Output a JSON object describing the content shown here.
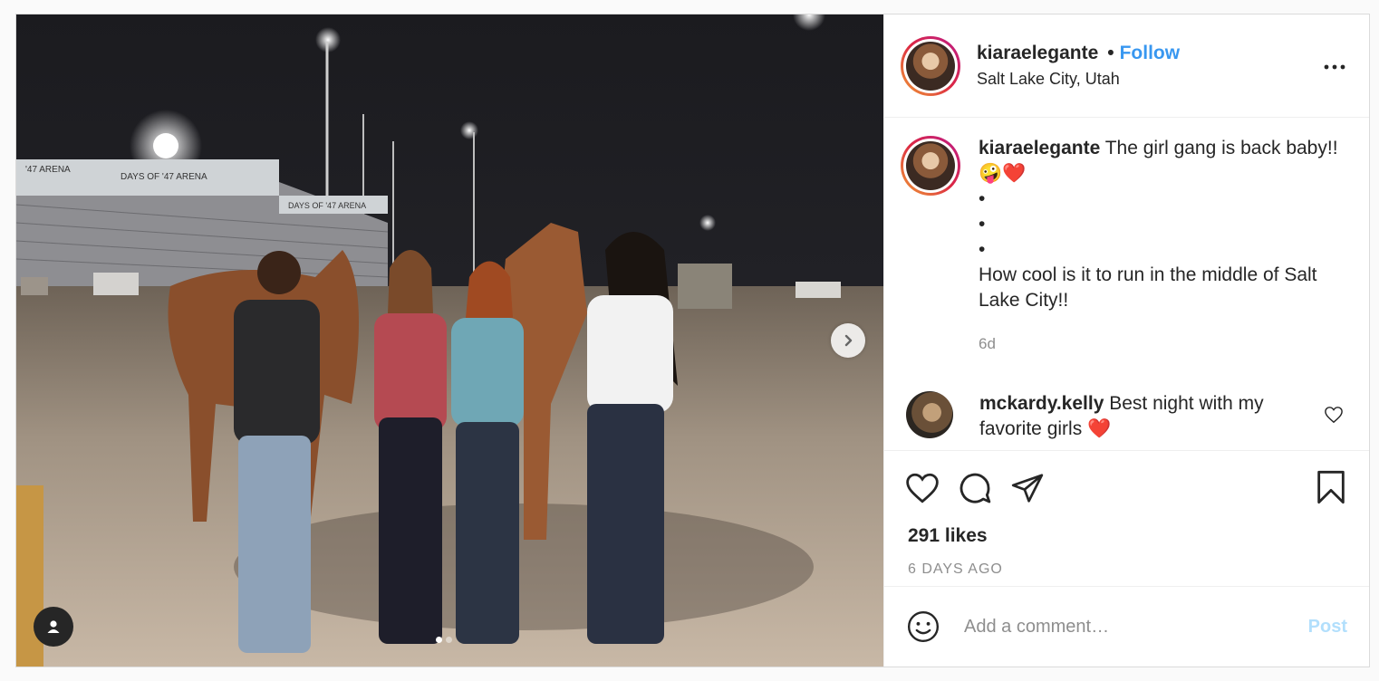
{
  "post": {
    "username": "kiaraelegante",
    "follow_label": "Follow",
    "bullet": "•",
    "location": "Salt Lake City, Utah",
    "caption_user": "kiaraelegante",
    "caption_text": "The girl gang is back baby!!🤪❤️",
    "caption_lines": [
      "•",
      "•",
      "•"
    ],
    "caption_tail": "How cool is it to run in the middle of Salt Lake City!!",
    "caption_time": "6d",
    "comments": [
      {
        "user": "mckardy.kelly",
        "text": "Best night with my favorite girls ❤️"
      }
    ],
    "likes": "291 likes",
    "posted_ago": "6 DAYS AGO",
    "add_comment_placeholder": "Add a comment…",
    "post_label": "Post"
  },
  "photo": {
    "banner_text_1": "'47 ARENA",
    "banner_text_2": "DAYS OF '47 ARENA",
    "banner_text_3": "DAYS OF '47 ARENA",
    "carousel_count": 2,
    "carousel_active": 1
  },
  "icons": {
    "more": "more-horizontal-icon",
    "next": "chevron-right-icon",
    "tag": "user-tag-icon",
    "like": "heart-icon",
    "comment": "comment-bubble-icon",
    "share": "paper-plane-icon",
    "save": "bookmark-icon",
    "emoji": "emoji-smile-icon"
  },
  "colors": {
    "accent": "#3897f0",
    "post_disabled": "#b2dffc",
    "muted": "#8e8e8e"
  }
}
